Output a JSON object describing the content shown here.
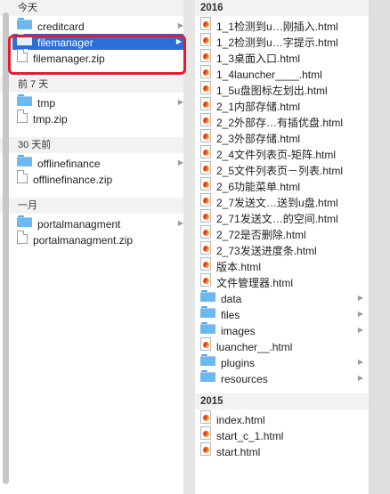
{
  "left_column": {
    "sections": [
      {
        "header": "今天",
        "items": [
          {
            "name": "creditcard",
            "type": "folder",
            "has_children": true
          },
          {
            "name": "filemanager",
            "type": "folder",
            "has_children": true,
            "selected": true
          },
          {
            "name": "filemanager.zip",
            "type": "file"
          }
        ]
      },
      {
        "header": "前 7 天",
        "items": [
          {
            "name": "tmp",
            "type": "folder",
            "has_children": true
          },
          {
            "name": "tmp.zip",
            "type": "file"
          }
        ]
      },
      {
        "header": "30 天前",
        "items": [
          {
            "name": "offlinefinance",
            "type": "folder",
            "has_children": true
          },
          {
            "name": "offlinefinance.zip",
            "type": "file"
          }
        ]
      },
      {
        "header": "一月",
        "items": [
          {
            "name": "portalmanagment",
            "type": "folder",
            "has_children": true
          },
          {
            "name": "portalmanagment.zip",
            "type": "file"
          }
        ]
      }
    ]
  },
  "right_column": {
    "sections": [
      {
        "header": "2016",
        "items": [
          {
            "name": "1_1检测到u…刚插入.html",
            "type": "html"
          },
          {
            "name": "1_2检测到u…字提示.html",
            "type": "html"
          },
          {
            "name": "1_3桌面入口.html",
            "type": "html"
          },
          {
            "name": "1_4launcher____.html",
            "type": "html"
          },
          {
            "name": "1_5u盘图标左划出.html",
            "type": "html"
          },
          {
            "name": "2_1内部存储.html",
            "type": "html"
          },
          {
            "name": "2_2外部存…有插优盘.html",
            "type": "html"
          },
          {
            "name": "2_3外部存储.html",
            "type": "html"
          },
          {
            "name": "2_4文件列表页-矩阵.html",
            "type": "html"
          },
          {
            "name": "2_5文件列表页－列表.html",
            "type": "html"
          },
          {
            "name": "2_6功能菜单.html",
            "type": "html"
          },
          {
            "name": "2_7发送文…送到u盘.html",
            "type": "html"
          },
          {
            "name": "2_71发送文…的空间.html",
            "type": "html"
          },
          {
            "name": "2_72是否删除.html",
            "type": "html"
          },
          {
            "name": "2_73发送进度条.html",
            "type": "html"
          },
          {
            "name": "版本.html",
            "type": "html"
          },
          {
            "name": "文件管理器.html",
            "type": "html"
          },
          {
            "name": "data",
            "type": "folder",
            "has_children": true
          },
          {
            "name": "files",
            "type": "folder",
            "has_children": true
          },
          {
            "name": "images",
            "type": "folder",
            "has_children": true
          },
          {
            "name": "luancher__.html",
            "type": "html"
          },
          {
            "name": "plugins",
            "type": "folder",
            "has_children": true
          },
          {
            "name": "resources",
            "type": "folder",
            "has_children": true
          }
        ]
      },
      {
        "header": "2015",
        "items": [
          {
            "name": "index.html",
            "type": "html"
          },
          {
            "name": "start_c_1.html",
            "type": "html"
          },
          {
            "name": "start.html",
            "type": "html"
          }
        ]
      }
    ]
  },
  "colors": {
    "selection": "#2c6fda",
    "highlight_border": "#e41b2a",
    "folder": "#6cb8f0",
    "html_icon": "#e2491d"
  },
  "icons": {
    "folder": "folder-icon",
    "file": "document-icon",
    "html": "html-file-icon",
    "expand": "chevron-right-icon"
  }
}
